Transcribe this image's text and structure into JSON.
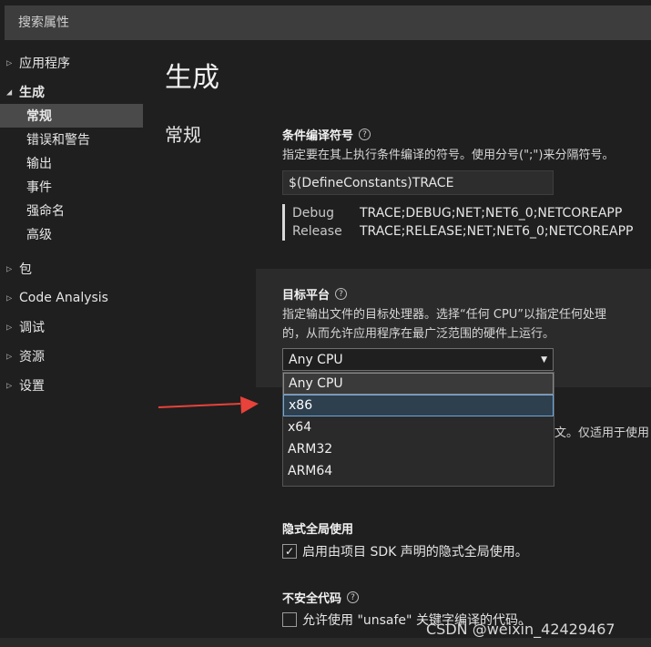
{
  "search": {
    "placeholder": "搜索属性"
  },
  "sidebar": {
    "items": [
      {
        "label": "应用程序"
      },
      {
        "label": "生成"
      },
      {
        "label": "常规"
      },
      {
        "label": "错误和警告"
      },
      {
        "label": "输出"
      },
      {
        "label": "事件"
      },
      {
        "label": "强命名"
      },
      {
        "label": "高级"
      },
      {
        "label": "包"
      },
      {
        "label": "Code Analysis"
      },
      {
        "label": "调试"
      },
      {
        "label": "资源"
      },
      {
        "label": "设置"
      }
    ]
  },
  "page": {
    "title": "生成",
    "section": "常规"
  },
  "conditional": {
    "label": "条件编译符号",
    "description": "指定要在其上执行条件编译的符号。使用分号(\";\")来分隔符号。",
    "value": "$(DefineConstants)TRACE",
    "configs": [
      {
        "name": "Debug",
        "value": "TRACE;DEBUG;NET;NET6_0;NETCOREAPP"
      },
      {
        "name": "Release",
        "value": "TRACE;RELEASE;NET;NET6_0;NETCOREAPP"
      }
    ]
  },
  "platform": {
    "label": "目标平台",
    "description_line1": "指定输出文件的目标处理器。选择“任何 CPU”以指定任何处理",
    "description_line2": "的，从而允许应用程序在最广泛范围的硬件上运行。",
    "selected": "Any CPU",
    "options": [
      "Any CPU",
      "x86",
      "x64",
      "ARM32",
      "ARM64"
    ],
    "highlighted": "x86",
    "partial_text": "文。仅适用于使用"
  },
  "implicit": {
    "label": "隐式全局使用",
    "checkbox_label": "启用由项目 SDK 声明的隐式全局使用。",
    "checked": true
  },
  "unsafe": {
    "label": "不安全代码",
    "checkbox_label": "允许使用 \"unsafe\" 关键字编译的代码。",
    "checked": false
  },
  "watermark": "CSDN @weixin_42429467",
  "colors": {
    "arrow": "#e8423a",
    "highlight_border": "#6fa8dc"
  }
}
